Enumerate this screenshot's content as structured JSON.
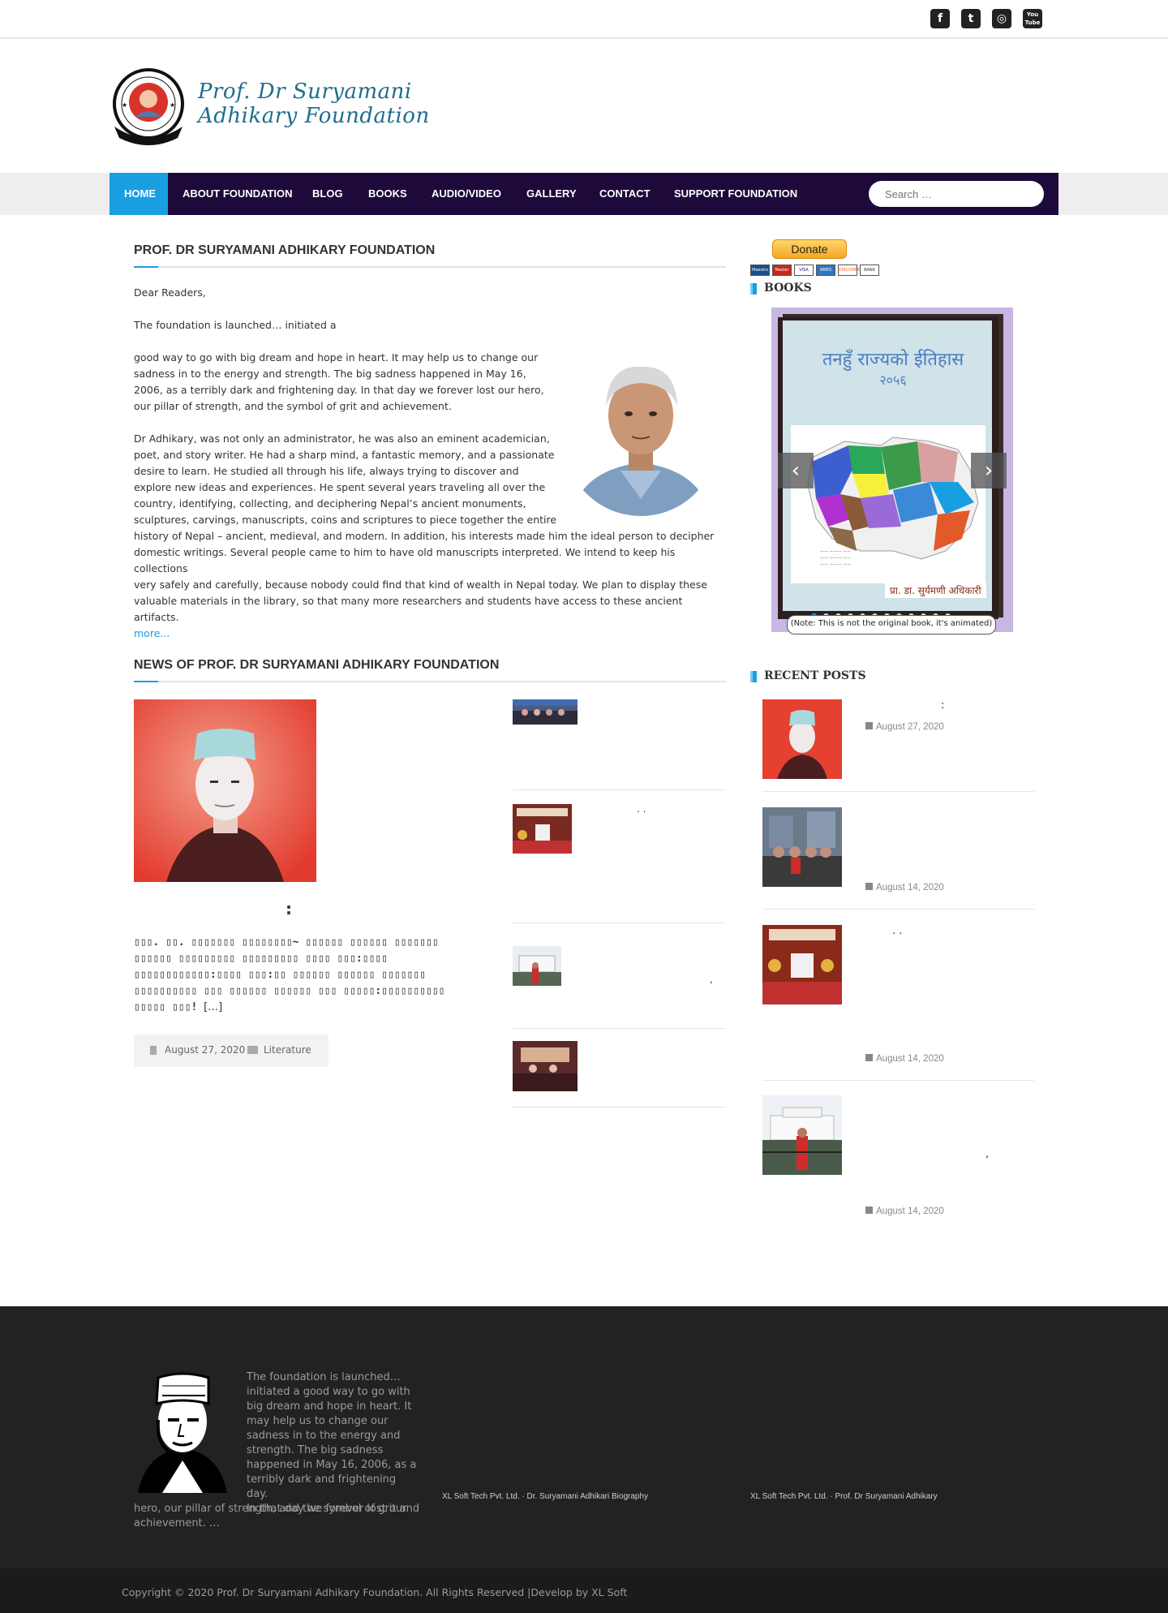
{
  "social": {
    "facebook": "f",
    "twitter": "t",
    "instagram": "◎",
    "youtube": "You Tube"
  },
  "header": {
    "logo_line1": "Prof. Dr Suryamani",
    "logo_line2": "Adhikary Foundation"
  },
  "nav": {
    "items": [
      {
        "label": "HOME"
      },
      {
        "label": "ABOUT FOUNDATION"
      },
      {
        "label": "BLOG"
      },
      {
        "label": "BOOKS"
      },
      {
        "label": "AUDIO/VIDEO"
      },
      {
        "label": "GALLERY"
      },
      {
        "label": "CONTACT"
      },
      {
        "label": "SUPPORT FOUNDATION"
      }
    ],
    "search_placeholder": "Search …"
  },
  "intro": {
    "title": "PROF. DR SURYAMANI ADHIKARY FOUNDATION",
    "greeting": "Dear Readers,",
    "p1": "The foundation is launched… initiated a",
    "p2_lines": [
      "good way to go with big dream and hope in heart. It may help us to change our",
      "sadness in to the energy and strength. The big sadness happened in May 16,",
      "2006, as a terribly dark and frightening day. In that day we forever lost our hero,",
      "our pillar of strength, and the symbol of grit and achievement."
    ],
    "p3_lines": [
      "Dr Adhikary, was not only an administrator, he was also an eminent academician,",
      "poet, and story writer. He had a sharp mind, a fantastic memory, and a passionate",
      "desire to learn. He studied all through his life, always trying to discover and",
      "explore new ideas and experiences. He spent several years traveling all over the",
      "country, identifying, collecting, and deciphering Nepal’s ancient monuments,",
      "sculptures, carvings, manuscripts, coins and scriptures to piece together the entire",
      "history of Nepal – ancient, medieval, and modern. In addition, his interests made him the ideal person to decipher",
      "domestic writings. Several people came to him to have old manuscripts interpreted. We intend to keep his collections",
      "very safely and carefully, because nobody could find that kind of wealth in Nepal today. We plan to display these",
      "valuable materials in the library, so that many more researchers and students have access to these ancient artifacts."
    ],
    "more": "more..."
  },
  "sidebar": {
    "donate": "Donate",
    "cards": [
      "Maestro",
      "Master",
      "VISA",
      "AMEX",
      "DISCOVER",
      "BANK"
    ],
    "books_title": "BOOKS",
    "book_title_nepali": "तनहुँ राज्यको ईतिहास",
    "book_year": "२०५६",
    "book_author": "प्रा. डा. सुर्यमणी अधिकारी",
    "book_note": "(Note: This is not the original book, it's animated)",
    "recent_title": "RECENT POSTS",
    "recent_posts": [
      {
        "title": ":",
        "date": "August 27, 2020"
      },
      {
        "title": "",
        "date": "August 14, 2020"
      },
      {
        "title": ". .",
        "date": "August 14, 2020"
      },
      {
        "title": ",",
        "date": "August 14, 2020"
      }
    ]
  },
  "news": {
    "title": "NEWS OF PROF. DR SURYAMANI ADHIKARY FOUNDATION",
    "main_title": ":",
    "excerpt": "▯▯▯. ▯▯. ▯▯▯▯▯▯▯ ▯▯▯▯▯▯▯▯~ ▯▯▯▯▯▯ ▯▯▯▯▯▯ ▯▯▯▯▯▯▯ ▯▯▯▯▯▯ ▯▯▯▯▯▯▯▯▯ ▯▯▯▯▯▯▯▯▯ ▯▯▯▯ ▯▯▯:▯▯▯▯ ▯▯▯▯▯▯▯▯▯▯▯▯:▯▯▯▯ ▯▯▯:▯▯ ▯▯▯▯▯▯ ▯▯▯▯▯▯ ▯▯▯▯▯▯▯ ▯▯▯▯▯▯▯▯▯▯ ▯▯▯ ▯▯▯▯▯▯ ▯▯▯▯▯▯ ▯▯▯ ▯▯▯▯▯:▯▯▯▯▯▯▯▯▯▯ ▯▯▯▯▯ ▯▯▯!",
    "excerpt_end": "[…]",
    "date": "August 27, 2020",
    "category": "Literature",
    "side_items": [
      {
        "title": ""
      },
      {
        "title": ". ."
      },
      {
        "title": ","
      },
      {
        "title": ""
      }
    ]
  },
  "footer": {
    "about": "The foundation is launched… initiated a good way to go with big dream and hope in heart. It may help us to change our sadness in to the energy and strength. The big sadness happened in May 16, 2006, as a terribly dark and frightening day. In that day we forever lost our hero, our pillar of strength, and the symbol of grit and achievement. …",
    "about_lines_right": [
      "The foundation is launched…",
      "initiated a good way to go with",
      "big dream and hope in heart. It",
      "may help us to change our",
      "sadness in to the energy and",
      "strength. The big sadness",
      "happened in May 16, 2006, as a",
      "terribly dark and frightening day.",
      "In that day we forever lost our"
    ],
    "about_lines_full": [
      "hero, our pillar of strength, and the symbol of grit and",
      "achievement. …"
    ],
    "link1": "XL Soft Tech Pvt. Ltd. · Dr. Suryamani Adhikari Biography",
    "link2": "XL Soft Tech Pvt. Ltd. · Prof. Dr Suryamani Adhikary",
    "copyright": "Copyright © 2020 Prof. Dr Suryamani Adhikary Foundation. All Rights Reserved |Develop by XL Soft"
  }
}
